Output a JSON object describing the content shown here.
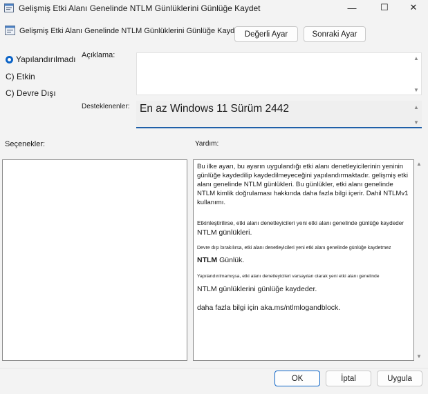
{
  "window": {
    "title": "Gelişmiş Etki Alanı Genelinde NTLM Günlüklerini Günlüğe Kaydet",
    "controls": {
      "minimize": "—",
      "maximize": "☐",
      "close": "✕"
    }
  },
  "header": {
    "policy_title": "Gelişmiş Etki Alanı Genelinde NTLM Günlüklerini Günlüğe Kaydet",
    "prev_button": "Değerli Ayar",
    "next_button": "Sonraki Ayar"
  },
  "state": {
    "options": [
      {
        "label": "Yapılandırılmadı",
        "selected": true
      },
      {
        "label": "C) Etkin",
        "selected": false
      },
      {
        "label": "C) Devre Dışı",
        "selected": false
      }
    ]
  },
  "comment": {
    "label": "Açıklama:",
    "value": ""
  },
  "supported": {
    "label": "Desteklenenler:",
    "value": "En az Windows 11 Sürüm 2442"
  },
  "options_panel": {
    "label": "Seçenekler:"
  },
  "help_panel": {
    "label": "Yardım:",
    "p1": "Bu ilke ayarı, bu ayarın uygulandığı etki alanı denetleyicilerinin yeninin günlüğe kaydedilip kaydedilmeyeceğini yapılandırmaktadır. gelişmiş etki alanı genelinde NTLM günlükleri. Bu günlükler, etki alanı genelinde NTLM kimlik doğrulaması hakkında daha fazla bilgi içerir. Dahil NTLMv1 kullanımı.",
    "p2a": "Etkinleştirilirse, etki alanı denetleyicileri yeni etki alanı genelinde günlüğe kaydeder",
    "p2b": "NTLM günlükleri.",
    "p3a": "Devre dışı bırakılırsa, etki alanı denetleyicileri yeni etki alanı genelinde günlüğe kaydetmez",
    "p3b": "NTLM",
    "p3c": "Günlük.",
    "p4a": "Yapılandırılmamışsa, etki alanı denetleyicileri varsayılan olarak yeni etki alanı genelinde",
    "p4b": "NTLM günlüklerini günlüğe kaydeder.",
    "p5": "daha fazla bilgi için aka.ms/ntlmlogandblock."
  },
  "footer": {
    "ok": "OK",
    "cancel": "İptal",
    "apply": "Uygula"
  },
  "colors": {
    "accent": "#0b63c6",
    "background": "#f3f3f3"
  },
  "icons": [
    "policy-icon",
    "up-arrow-icon",
    "down-arrow-icon"
  ]
}
